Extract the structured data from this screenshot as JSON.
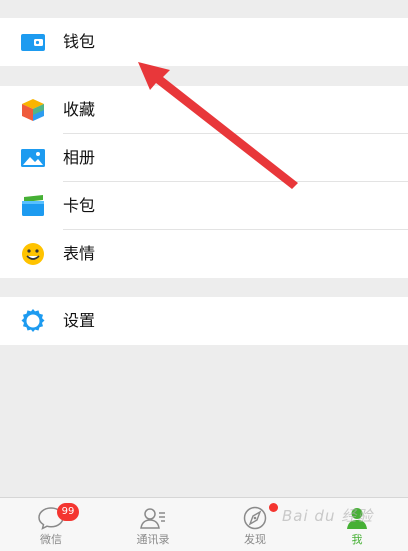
{
  "menu": {
    "wallet": {
      "label": "钱包",
      "icon": "wallet-icon"
    },
    "items": [
      {
        "label": "收藏",
        "icon": "cube-icon"
      },
      {
        "label": "相册",
        "icon": "photo-icon"
      },
      {
        "label": "卡包",
        "icon": "card-icon"
      },
      {
        "label": "表情",
        "icon": "smiley-icon"
      }
    ],
    "settings": {
      "label": "设置",
      "icon": "gear-icon"
    }
  },
  "tabs": [
    {
      "label": "微信",
      "icon": "chat-icon",
      "badge": "99"
    },
    {
      "label": "通讯录",
      "icon": "contacts-icon"
    },
    {
      "label": "发现",
      "icon": "compass-icon",
      "has_dot": true
    },
    {
      "label": "我",
      "icon": "me-icon",
      "active": true
    }
  ],
  "watermark": "Bai du 经验",
  "colors": {
    "active_green": "#46b035",
    "badge_red": "#f43530",
    "icon_blue": "#1d9bf0",
    "arrow_red": "#e8373a"
  }
}
